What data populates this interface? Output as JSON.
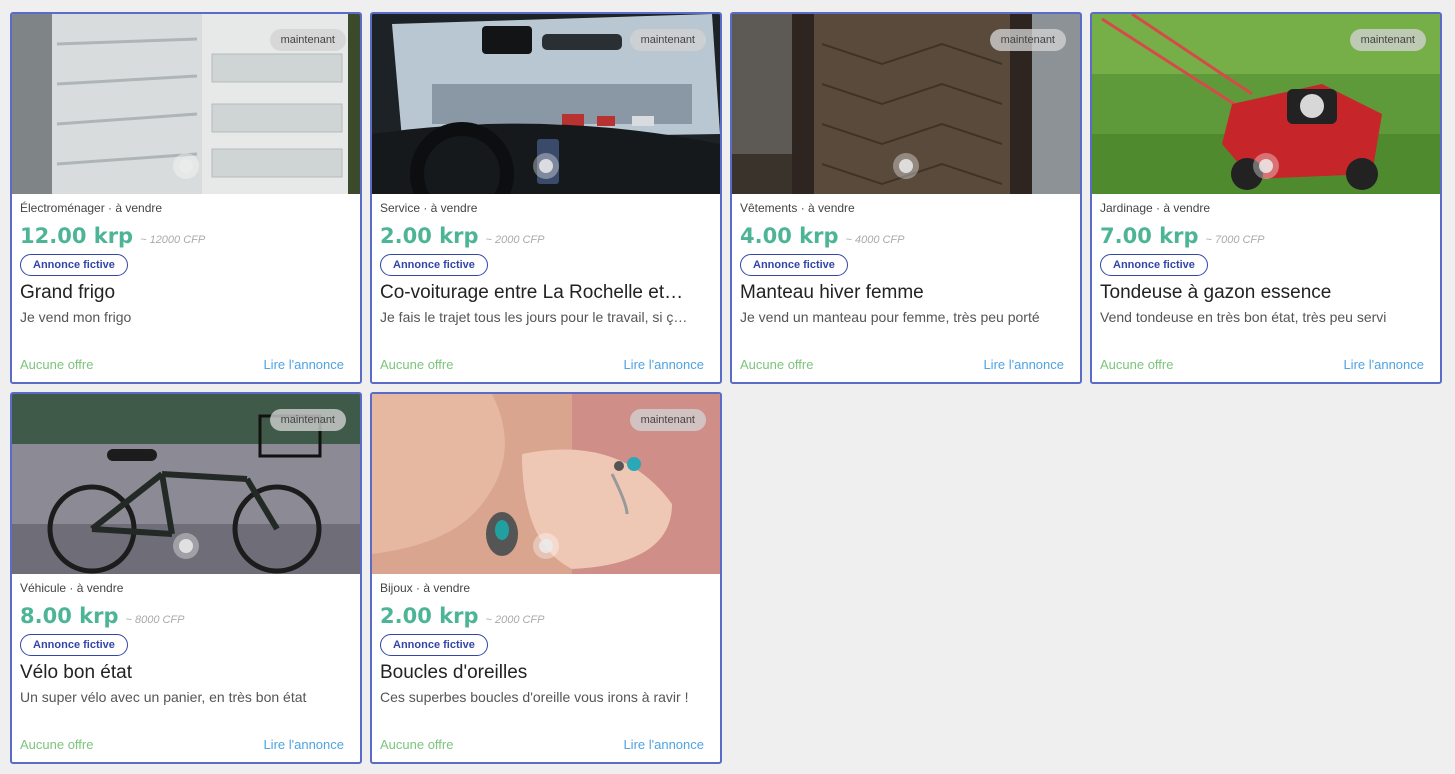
{
  "listings": [
    {
      "time": "maintenant",
      "category": "Électroménager · à vendre",
      "price": "12.00 krp",
      "price_cfp": "~ 12000 CFP",
      "badge": "Annonce fictive",
      "title": "Grand frigo",
      "description": "Je vend mon frigo",
      "offers": "Aucune offre",
      "read_link": "Lire l'annonce"
    },
    {
      "time": "maintenant",
      "category": "Service · à vendre",
      "price": "2.00 krp",
      "price_cfp": "~ 2000 CFP",
      "badge": "Annonce fictive",
      "title": "Co-voiturage entre La Rochelle et…",
      "description": "Je fais le trajet tous les jours pour le travail, si ç…",
      "offers": "Aucune offre",
      "read_link": "Lire l'annonce"
    },
    {
      "time": "maintenant",
      "category": "Vêtements · à vendre",
      "price": "4.00 krp",
      "price_cfp": "~ 4000 CFP",
      "badge": "Annonce fictive",
      "title": "Manteau hiver femme",
      "description": "Je vend un manteau pour femme, très peu porté",
      "offers": "Aucune offre",
      "read_link": "Lire l'annonce"
    },
    {
      "time": "maintenant",
      "category": "Jardinage · à vendre",
      "price": "7.00 krp",
      "price_cfp": "~ 7000 CFP",
      "badge": "Annonce fictive",
      "title": "Tondeuse à gazon essence",
      "description": "Vend tondeuse en très bon état, très peu servi",
      "offers": "Aucune offre",
      "read_link": "Lire l'annonce"
    },
    {
      "time": "maintenant",
      "category": "Véhicule · à vendre",
      "price": "8.00 krp",
      "price_cfp": "~ 8000 CFP",
      "badge": "Annonce fictive",
      "title": "Vélo bon état",
      "description": "Un super vélo avec un panier, en très bon état",
      "offers": "Aucune offre",
      "read_link": "Lire l'annonce"
    },
    {
      "time": "maintenant",
      "category": "Bijoux · à vendre",
      "price": "2.00 krp",
      "price_cfp": "~ 2000 CFP",
      "badge": "Annonce fictive",
      "title": "Boucles d'oreilles",
      "description": "Ces superbes boucles d'oreille vous irons à ravir !",
      "offers": "Aucune offre",
      "read_link": "Lire l'annonce"
    }
  ],
  "colors": {
    "card_border": "#5b6bc8",
    "price": "#4db596",
    "badge": "#3346a8",
    "offers": "#7cc47c",
    "link": "#4fa3e0",
    "background": "#efefef"
  }
}
